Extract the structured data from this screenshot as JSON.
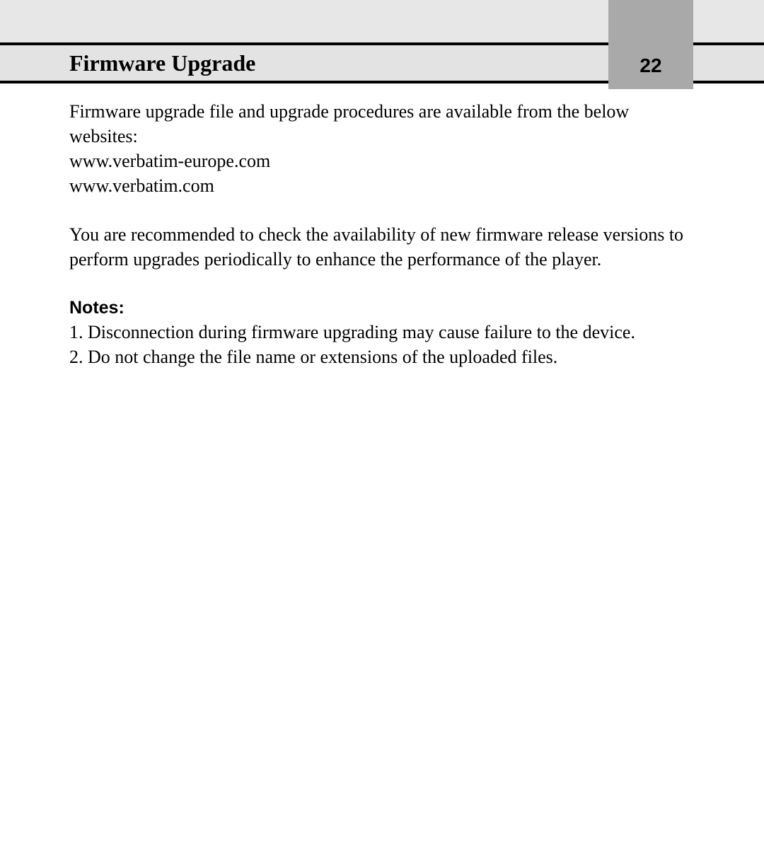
{
  "header": {
    "title": "Firmware Upgrade",
    "page_number": "22"
  },
  "body": {
    "intro_line": "Firmware upgrade file and upgrade procedures are available from the below websites:",
    "website1": "www.verbatim-europe.com",
    "website2": "www.verbatim.com",
    "recommend": "You are recommended to check the availability of new firmware release versions to perform upgrades periodically to enhance the performance of the player.",
    "notes_label": "Notes:",
    "note1": "1. Disconnection during firmware upgrading may cause failure to the device.",
    "note2": "2. Do not change the file name or extensions of the uploaded files."
  }
}
